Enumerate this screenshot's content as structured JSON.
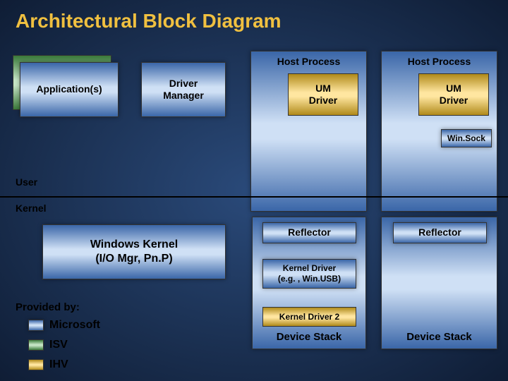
{
  "title": "Architectural Block Diagram",
  "blocks": {
    "applications": "Application(s)",
    "driver_manager": "Driver\nManager",
    "host_process_1": "Host Process",
    "host_process_2": "Host Process",
    "um_driver_1": "UM\nDriver",
    "um_driver_2": "UM\nDriver",
    "winsock": "Win.Sock",
    "reflector_1": "Reflector",
    "reflector_2": "Reflector",
    "windows_kernel": "Windows Kernel\n(I/O Mgr, Pn.P)",
    "kernel_driver_1": "Kernel Driver\n(e.g. , Win.USB)",
    "kernel_driver_2": "Kernel Driver 2",
    "device_stack_1": "Device Stack",
    "device_stack_2": "Device Stack"
  },
  "sections": {
    "user": "User",
    "kernel": "Kernel"
  },
  "legend": {
    "heading": "Provided by:",
    "items": [
      {
        "label": "Microsoft",
        "key": "microsoft"
      },
      {
        "label": "ISV",
        "key": "isv"
      },
      {
        "label": "IHV",
        "key": "ihv"
      }
    ]
  }
}
